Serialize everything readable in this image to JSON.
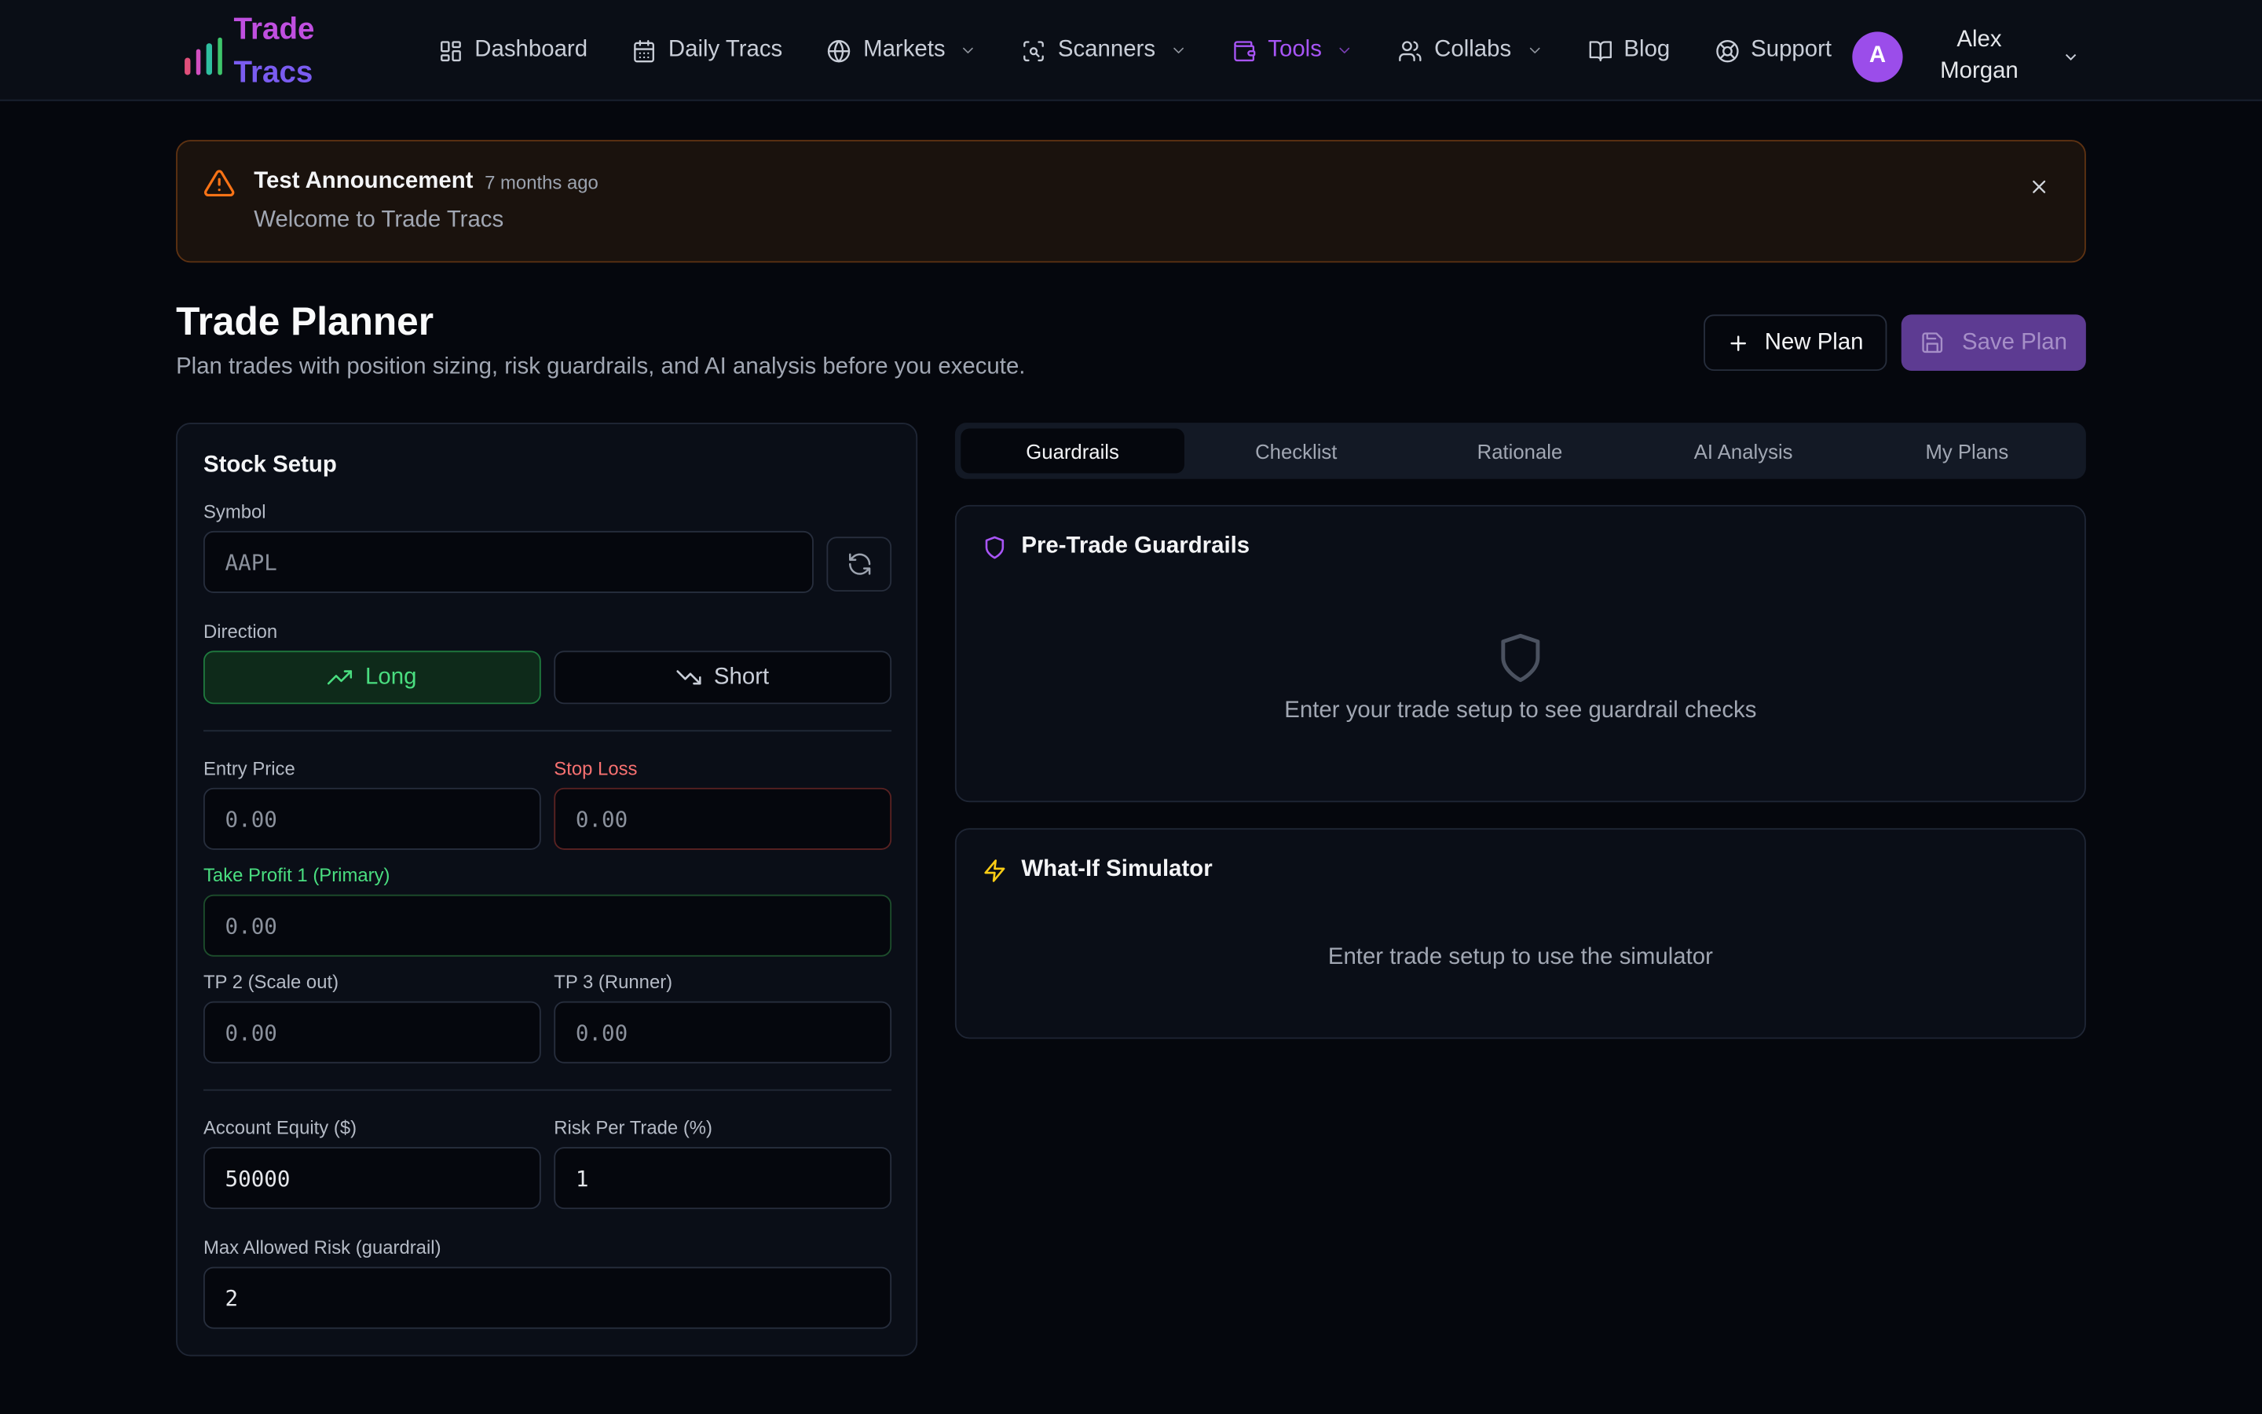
{
  "brand": {
    "line1": "Trade",
    "line2": "Tracs",
    "bar_colors": [
      "#e04f7a",
      "#d24fc0",
      "#2fbfa0",
      "#3ec56b"
    ]
  },
  "nav": {
    "items": [
      {
        "label": "Dashboard",
        "icon": "dashboard-icon",
        "dropdown": false,
        "active": false
      },
      {
        "label": "Daily Tracs",
        "icon": "calendar-icon",
        "dropdown": false,
        "active": false
      },
      {
        "label": "Markets",
        "icon": "globe-icon",
        "dropdown": true,
        "active": false
      },
      {
        "label": "Scanners",
        "icon": "scan-icon",
        "dropdown": true,
        "active": false
      },
      {
        "label": "Tools",
        "icon": "wallet-icon",
        "dropdown": true,
        "active": true
      },
      {
        "label": "Collabs",
        "icon": "users-icon",
        "dropdown": true,
        "active": false
      },
      {
        "label": "Blog",
        "icon": "book-icon",
        "dropdown": false,
        "active": false
      },
      {
        "label": "Support",
        "icon": "lifebuoy-icon",
        "dropdown": false,
        "active": false
      }
    ],
    "user": {
      "initial": "A",
      "first_name": "Alex",
      "last_name": "Morgan"
    }
  },
  "announcement": {
    "title": "Test Announcement",
    "time": "7 months ago",
    "message": "Welcome to Trade Tracs"
  },
  "header": {
    "title": "Trade Planner",
    "subtitle": "Plan trades with position sizing, risk guardrails, and AI analysis before you execute.",
    "new_plan_label": "New Plan",
    "save_plan_label": "Save Plan"
  },
  "stock_setup": {
    "title": "Stock Setup",
    "symbol_label": "Symbol",
    "symbol_value": "AAPL",
    "direction_label": "Direction",
    "long_label": "Long",
    "short_label": "Short",
    "selected_direction": "Long",
    "entry_label": "Entry Price",
    "entry_value": "0.00",
    "stop_label": "Stop Loss",
    "stop_value": "0.00",
    "tp1_label": "Take Profit 1 (Primary)",
    "tp1_value": "0.00",
    "tp2_label": "TP 2 (Scale out)",
    "tp2_value": "0.00",
    "tp3_label": "TP 3 (Runner)",
    "tp3_value": "0.00",
    "equity_label": "Account Equity ($)",
    "equity_value": "50000",
    "risk_label": "Risk Per Trade (%)",
    "risk_value": "1",
    "max_risk_label": "Max Allowed Risk (guardrail)",
    "max_risk_value": "2"
  },
  "tabs": [
    "Guardrails",
    "Checklist",
    "Rationale",
    "AI Analysis",
    "My Plans"
  ],
  "active_tab": "Guardrails",
  "guardrails": {
    "title": "Pre-Trade Guardrails",
    "empty_text": "Enter your trade setup to see guardrail checks"
  },
  "simulator": {
    "title": "What-If Simulator",
    "empty_text": "Enter trade setup to use the simulator"
  },
  "colors": {
    "accent": "#a855f7",
    "long_green": "#4ade80",
    "stop_red": "#f87171",
    "warning_orange": "#f97316",
    "simulator_yellow": "#facc15"
  }
}
